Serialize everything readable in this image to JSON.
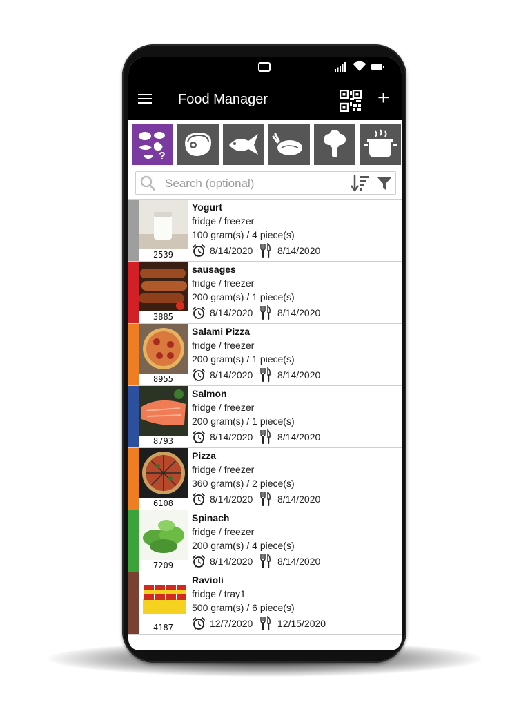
{
  "app": {
    "title": "Food Manager",
    "add_label": "+",
    "menu_icon": "menu-icon",
    "qr_icon": "qr-code-icon"
  },
  "status_bar": {
    "icons": [
      "navigation-icon",
      "signal-icon",
      "wifi-icon",
      "battery-icon"
    ]
  },
  "categories": [
    {
      "icon": "mixed-food-icon",
      "active": true
    },
    {
      "icon": "meat-steak-icon",
      "active": false
    },
    {
      "icon": "fish-icon",
      "active": false
    },
    {
      "icon": "poultry-icon",
      "active": false
    },
    {
      "icon": "vegetable-broccoli-icon",
      "active": false
    },
    {
      "icon": "cooking-pot-icon",
      "active": false
    }
  ],
  "search": {
    "placeholder": "Search (optional)",
    "value": "",
    "sort_icon": "sort-icon",
    "filter_icon": "filter-icon"
  },
  "items": [
    {
      "name": "Yogurt",
      "location": "fridge / freezer",
      "quantity": "100 gram(s) / 4 piece(s)",
      "code": "2539",
      "date_alarm": "8/14/2020",
      "date_eat": "8/14/2020",
      "color": "#9e9e9e"
    },
    {
      "name": "sausages",
      "location": "fridge / freezer",
      "quantity": "200 gram(s) / 1 piece(s)",
      "code": "3885",
      "date_alarm": "8/14/2020",
      "date_eat": "8/14/2020",
      "color": "#d31f26"
    },
    {
      "name": "Salami Pizza",
      "location": "fridge / freezer",
      "quantity": "200 gram(s) / 1 piece(s)",
      "code": "8955",
      "date_alarm": "8/14/2020",
      "date_eat": "8/14/2020",
      "color": "#ef7d22"
    },
    {
      "name": "Salmon",
      "location": "fridge / freezer",
      "quantity": "200 gram(s) / 1 piece(s)",
      "code": "8793",
      "date_alarm": "8/14/2020",
      "date_eat": "8/14/2020",
      "color": "#2c4f9e"
    },
    {
      "name": "Pizza",
      "location": "fridge / freezer",
      "quantity": "360 gram(s) / 2 piece(s)",
      "code": "6108",
      "date_alarm": "8/14/2020",
      "date_eat": "8/14/2020",
      "color": "#ef7d22"
    },
    {
      "name": "Spinach",
      "location": "fridge / freezer",
      "quantity": "200 gram(s) / 4 piece(s)",
      "code": "7209",
      "date_alarm": "8/14/2020",
      "date_eat": "8/14/2020",
      "color": "#3aa43a"
    },
    {
      "name": "Ravioli",
      "location": "fridge / tray1",
      "quantity": "500 gram(s) / 6 piece(s)",
      "code": "4187",
      "date_alarm": "12/7/2020",
      "date_eat": "12/15/2020",
      "color": "#7a4030"
    }
  ]
}
